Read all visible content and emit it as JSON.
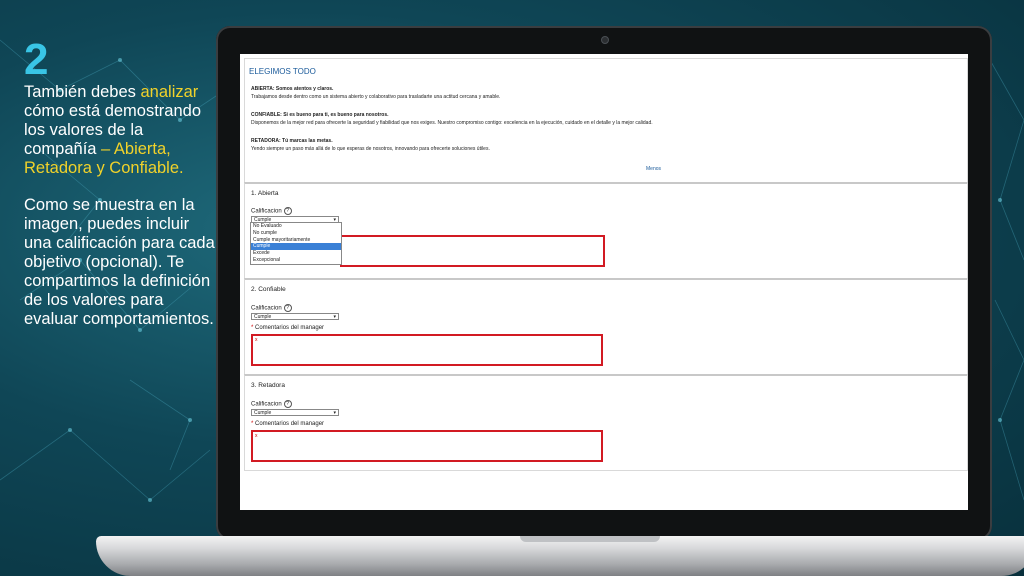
{
  "slide": {
    "number": "2",
    "para1_part1": "También  debes ",
    "para1_hl1": "analizar",
    "para1_part2": " cómo está demostrando los valores de la compañía ",
    "para1_hl2": "– Abierta, Retadora y Confiable.",
    "para2": "Como se muestra en la imagen, puedes incluir una calificación para cada objetivo (opcional). Te compartimos la definición de los valores para evaluar comportamientos."
  },
  "values_panel": {
    "title": "ELEGIMOS TODO",
    "items": [
      {
        "heading": "ABIERTA: Somos atentos y claros.",
        "text": "Trabajamos desde dentro como un sistema abierto y colaborativo para trasladarte una actitud cercana y amable."
      },
      {
        "heading": "CONFIABLE: Si es bueno para ti, es bueno para nosotros.",
        "text": "Disponemos de la mejor red para ofrecerte la seguridad y fiabilidad que nos exiges. Nuestro compromiso contigo: excelencia en la ejecución, cuidado en el detalle y la mejor calidad."
      },
      {
        "heading": "RETADORA: Tú marcas las metas.",
        "text": "Yendo siempre un paso más allá de lo que esperas de nosotros, innovando para ofrecerte soluciones útiles."
      }
    ],
    "less_link": "Menos"
  },
  "sections": [
    {
      "title": "1. Abierta",
      "rating_label": "Calificacion",
      "rating_value": "Cumple"
    },
    {
      "title": "2. Confiable",
      "rating_label": "Calificacion",
      "rating_value": "Cumple",
      "comments_label": "Comentarios del manager",
      "comments_value": "x"
    },
    {
      "title": "3. Retadora",
      "rating_label": "Calificacion",
      "rating_value": "Cumple",
      "comments_label": "Comentarios del manager",
      "comments_value": "x"
    }
  ],
  "required_marker": "*",
  "help_glyph": "?",
  "dropdown_arrow": "▾",
  "dropdown_options": [
    "No Evaluado",
    "No cumple",
    "Cumple mayoritariamente",
    "Cumple",
    "Excede",
    "Excepcional"
  ],
  "dropdown_selected_index": 3
}
